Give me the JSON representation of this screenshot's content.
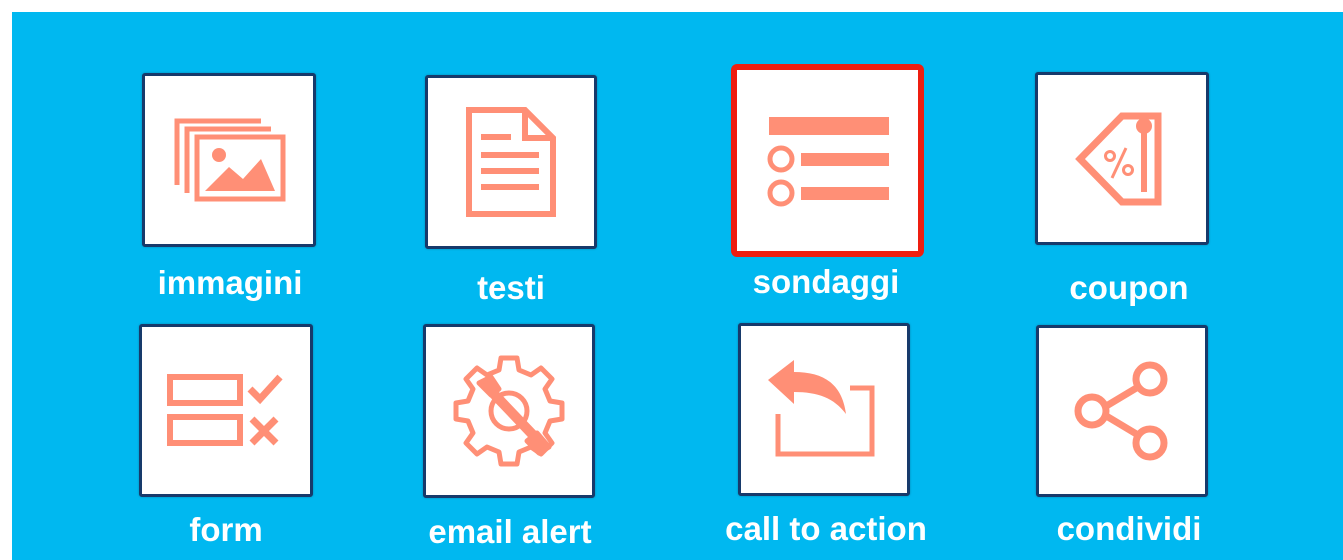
{
  "accent_color": "#ff8f76",
  "background_color": "#00b8f0",
  "selected_color": "#ee1e10",
  "tiles": [
    {
      "label": "immagini",
      "icon": "images-icon",
      "selected": false
    },
    {
      "label": "testi",
      "icon": "document-icon",
      "selected": false
    },
    {
      "label": "sondaggi",
      "icon": "survey-list-icon",
      "selected": true
    },
    {
      "label": "coupon",
      "icon": "coupon-tag-icon",
      "selected": false
    },
    {
      "label": "form",
      "icon": "form-checklist-icon",
      "selected": false
    },
    {
      "label": "email alert",
      "icon": "gear-wrench-icon",
      "selected": false
    },
    {
      "label": "call to action",
      "icon": "reply-arrow-icon",
      "selected": false
    },
    {
      "label": "condividi",
      "icon": "share-icon",
      "selected": false
    }
  ]
}
